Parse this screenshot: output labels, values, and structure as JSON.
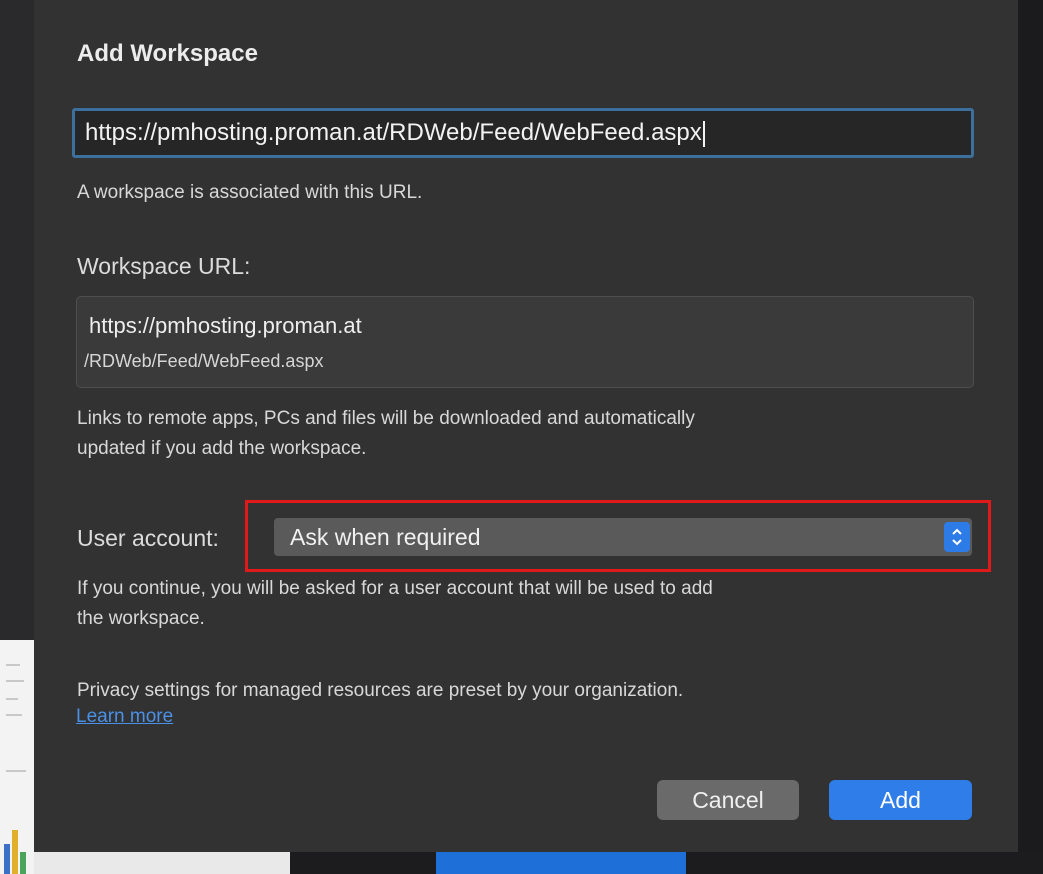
{
  "dialog": {
    "title": "Add Workspace",
    "url_input_value": "https://pmhosting.proman.at/RDWeb/Feed/WebFeed.aspx",
    "url_hint": "A workspace is associated with this URL.",
    "workspace_url_label": "Workspace URL:",
    "workspace_url_line1": "https://pmhosting.proman.at",
    "workspace_url_line2": "/RDWeb/Feed/WebFeed.aspx",
    "links_hint_line1": "Links to remote apps, PCs and files will be downloaded and automatically",
    "links_hint_line2": "updated if you add the workspace.",
    "user_account_label": "User account:",
    "user_account_selected": "Ask when required",
    "continue_hint_line1": "If you continue, you will be asked for a user account that will be used to add",
    "continue_hint_line2": "the workspace.",
    "privacy_text": "Privacy settings for managed resources are preset by your organization.",
    "learn_more_label": "Learn more",
    "cancel_label": "Cancel",
    "add_label": "Add"
  },
  "icons": {
    "select_arrows": "chevron-up-down-icon"
  },
  "colors": {
    "dialog_background": "#323232",
    "accent": "#2f7de8",
    "highlight_box": "#e01a1a",
    "link": "#4a90e6"
  }
}
